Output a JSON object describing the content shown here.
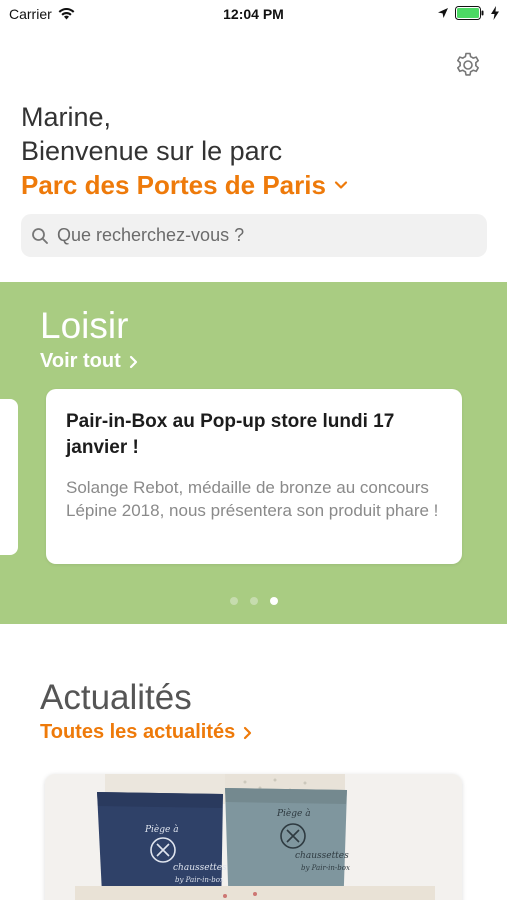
{
  "status_bar": {
    "carrier": "Carrier",
    "time": "12:04 PM",
    "battery_color": "#4cd964"
  },
  "header": {
    "settings_icon": "gear-icon"
  },
  "greeting": {
    "name": "Marine,",
    "welcome": "Bienvenue sur le parc",
    "park_name": "Parc des Portes de Paris",
    "park_color": "#ee7a0a"
  },
  "search": {
    "placeholder": "Que recherchez-vous ?",
    "value": ""
  },
  "leisure": {
    "title": "Loisir",
    "see_all": "Voir tout",
    "background": "#a9cc82",
    "card": {
      "title": "Pair-in-Box au Pop-up store lundi 17 janvier !",
      "text": "Solange Rebot, médaille de bronze au concours Lépine 2018, nous présentera son produit phare !"
    },
    "pagination": {
      "pages": 3,
      "active": 3
    }
  },
  "news": {
    "title": "Actualités",
    "see_all": "Toutes les actualités",
    "image": {
      "bag_left": {
        "line1": "Piège à",
        "line2": "chaussettes",
        "brand": "by Pair-in-box"
      },
      "bag_right": {
        "line1": "Piège à",
        "line2": "chaussettes",
        "brand": "by Pair-in-box"
      }
    }
  }
}
